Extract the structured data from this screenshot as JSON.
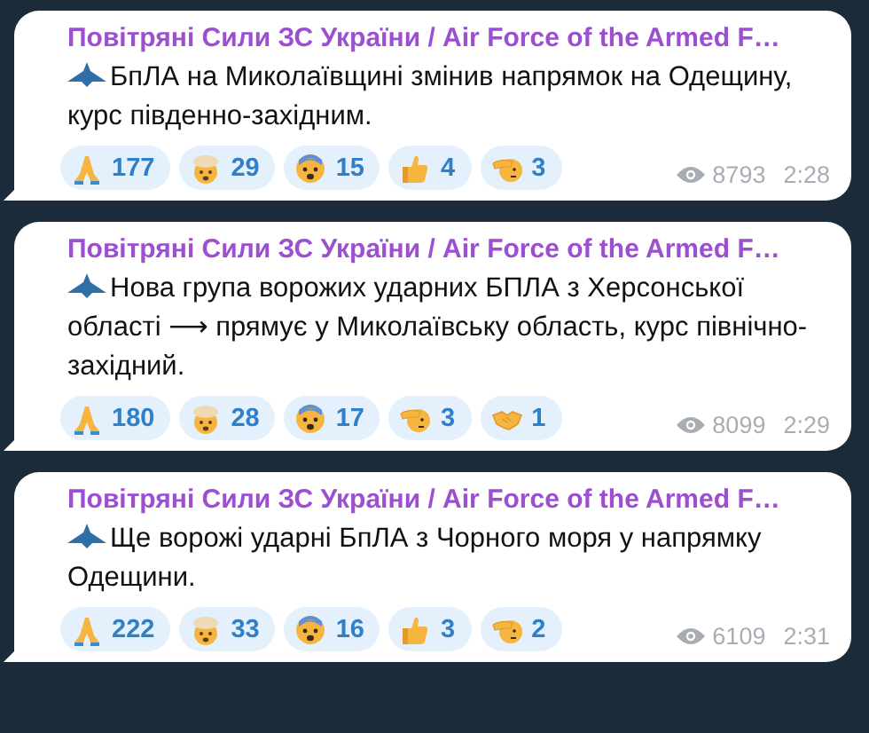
{
  "messages": [
    {
      "channel": "Повітряні Сили ЗС України / Air Force of the Armed F…",
      "text": "БпЛА на Миколаївщині змінив напрямок на Одещину, курс південно-західним.",
      "reactions": [
        {
          "kind": "pray",
          "count": "177"
        },
        {
          "kind": "exploding",
          "count": "29"
        },
        {
          "kind": "fearful",
          "count": "15"
        },
        {
          "kind": "thumbsup",
          "count": "4"
        },
        {
          "kind": "salute",
          "count": "3"
        }
      ],
      "views": "8793",
      "time": "2:28"
    },
    {
      "channel": "Повітряні Сили ЗС України / Air Force of the Armed F…",
      "text": "Нова група ворожих ударних БПЛА з Херсонської області ⟶ прямує у Миколаївську область, курс північно-західний.",
      "reactions": [
        {
          "kind": "pray",
          "count": "180"
        },
        {
          "kind": "exploding",
          "count": "28"
        },
        {
          "kind": "fearful",
          "count": "17"
        },
        {
          "kind": "salute",
          "count": "3"
        },
        {
          "kind": "handshake",
          "count": "1"
        }
      ],
      "views": "8099",
      "time": "2:29"
    },
    {
      "channel": "Повітряні Сили ЗС України / Air Force of the Armed F…",
      "text": "Ще ворожі ударні БпЛА з Чорного моря у напрямку Одещини.",
      "reactions": [
        {
          "kind": "pray",
          "count": "222"
        },
        {
          "kind": "exploding",
          "count": "33"
        },
        {
          "kind": "fearful",
          "count": "16"
        },
        {
          "kind": "thumbsup",
          "count": "3"
        },
        {
          "kind": "salute",
          "count": "2"
        }
      ],
      "views": "6109",
      "time": "2:31"
    }
  ]
}
